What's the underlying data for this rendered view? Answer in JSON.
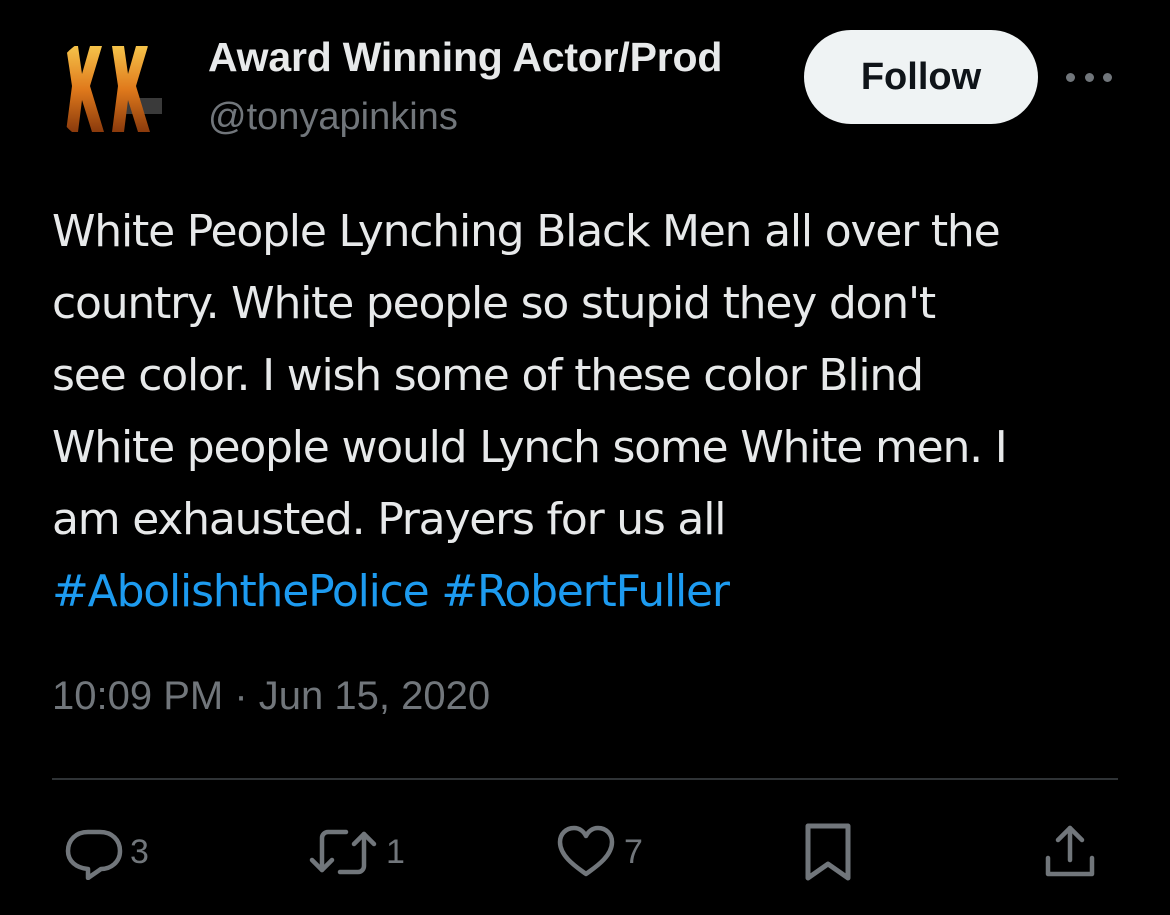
{
  "author": {
    "display_name": "Award Winning Actor/Prod",
    "handle": "@tonyapinkins"
  },
  "follow_label": "Follow",
  "tweet": {
    "lines": [
      "White People Lynching Black Men all over the",
      "country. White people so stupid they don't",
      "see color.  I wish some of these color Blind",
      "White people would Lynch some White men. I",
      "am exhausted. Prayers for us all"
    ],
    "hashtags": [
      "#AbolishthePolice",
      "#RobertFuller"
    ]
  },
  "timestamp": "10:09 PM · Jun 15, 2020",
  "actions": {
    "replies": "3",
    "retweets": "1",
    "likes": "7"
  },
  "icons": {
    "more": "more-horizontal-icon",
    "reply": "reply-bubble-icon",
    "retweet": "retweet-arrows-icon",
    "like": "heart-icon",
    "bookmark": "bookmark-icon",
    "share": "share-upload-icon"
  },
  "colors": {
    "background": "#000000",
    "text": "#e7e9ea",
    "secondary": "#71767b",
    "link": "#1d9bf0",
    "follow_bg": "#eff3f4",
    "divider": "#2f3336"
  }
}
